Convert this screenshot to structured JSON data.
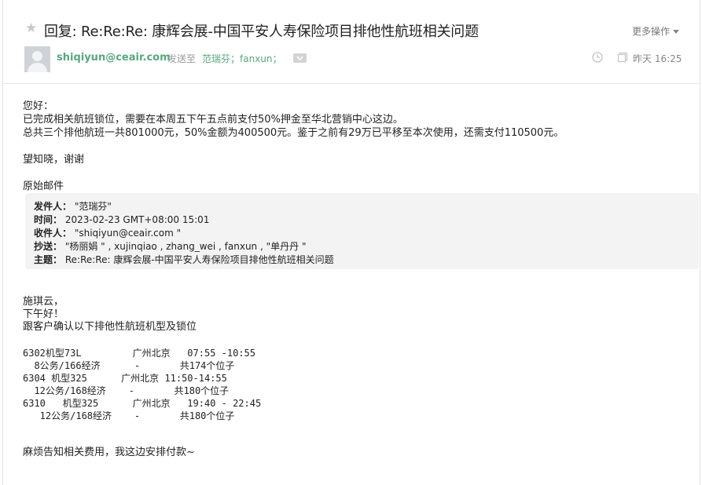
{
  "header": {
    "subject": "回复: Re:Re:Re: 康辉会展-中国平安人寿保险项目排他性航班相关问题",
    "more_label": "更多操作",
    "sender": "shiqiyun@ceair.com",
    "sent_to_label": "发送至",
    "recipients": "范瑞芬；fanxun；",
    "date": "昨天 16:25"
  },
  "body": {
    "greeting": "您好：",
    "line1": "已完成相关航班锁位，需要在本周五下午五点前支付50%押金至华北营销中心这边。",
    "line2": "总共三个排他航班一共801000元，50%金额为400500元。鉴于之前有29万已平移至本次使用，还需支付110500元。",
    "line3": "望知晓，谢谢",
    "original_label": "原始邮件"
  },
  "quote": {
    "from_label": "发件人：",
    "from_value": "\"范瑞芬\"",
    "time_label": "时间：",
    "time_value": "2023-02-23 GMT+08:00 15:01",
    "to_label": "收件人：",
    "to_value": "\"shiqiyun@ceair.com \"",
    "cc_label": "抄送：",
    "cc_value": "\"杨丽娟 \" , xujinqiao , zhang_wei , fanxun , \"单丹丹 \"",
    "subject_label": "主题：",
    "subject_value": "Re:Re:Re: 康辉会展-中国平安人寿保险项目排他性航班相关问题"
  },
  "original": {
    "name": "施琪云，",
    "afternoon": "下午好！",
    "intro": "跟客户确认以下排他性航班机型及锁位",
    "flights": [
      "6302机型73L         广州北京   07:55 -10:55",
      "  8公务/166经济      -       共174个位子",
      "6304 机型325      广州北京 11:50-14:55",
      "  12公务/168经济    -       共180个位子",
      "6310   机型325      广州北京   19:40 - 22:45",
      "   12公务/168经济    -       共180个位子"
    ],
    "closing": "麻烦告知相关费用，我这边安排付款~"
  }
}
